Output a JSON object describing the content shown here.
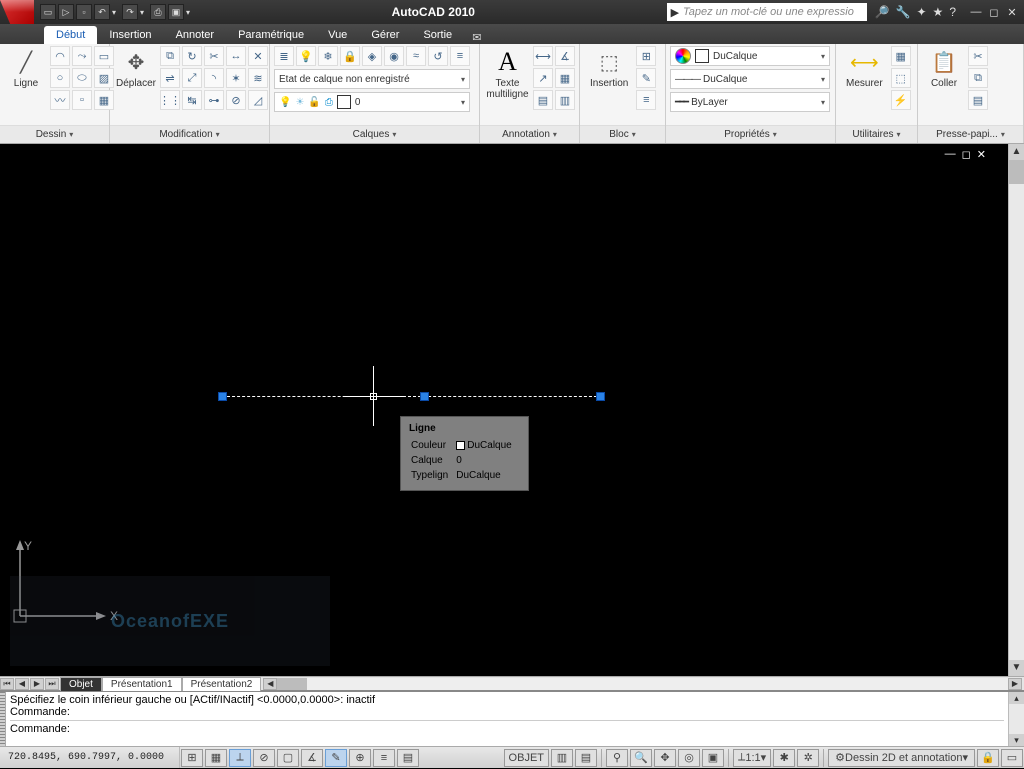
{
  "app": {
    "title": "AutoCAD 2010"
  },
  "search": {
    "placeholder": "Tapez un mot-clé ou une expressio"
  },
  "menu_tabs": {
    "debut": "Début",
    "insertion": "Insertion",
    "annoter": "Annoter",
    "parametrique": "Paramétrique",
    "vue": "Vue",
    "gerer": "Gérer",
    "sortie": "Sortie"
  },
  "panels": {
    "dessin": {
      "label": "Dessin",
      "ligne": "Ligne"
    },
    "modif": {
      "label": "Modification",
      "deplacer": "Déplacer"
    },
    "calques": {
      "label": "Calques",
      "state": "Etat de calque non enregistré",
      "current": "0"
    },
    "annot": {
      "label": "Annotation",
      "texte": "Texte\nmultiligne"
    },
    "bloc": {
      "label": "Bloc",
      "insertion": "Insertion"
    },
    "props": {
      "label": "Propriétés",
      "color": "DuCalque",
      "ltype": "DuCalque",
      "lweight": "ByLayer"
    },
    "util": {
      "label": "Utilitaires",
      "mesurer": "Mesurer"
    },
    "presse": {
      "label": "Presse-papi...",
      "coller": "Coller"
    }
  },
  "tooltip": {
    "title": "Ligne",
    "rows": [
      {
        "k": "Couleur",
        "v": "DuCalque",
        "sw": true
      },
      {
        "k": "Calque",
        "v": "0"
      },
      {
        "k": "Typelign",
        "v": "DuCalque"
      }
    ]
  },
  "ucs": {
    "x": "X",
    "y": "Y"
  },
  "watermark": "OceanofEXE",
  "layout": {
    "objet": "Objet",
    "p1": "Présentation1",
    "p2": "Présentation2"
  },
  "command": {
    "l1": "Spécifiez le coin inférieur gauche ou [ACtif/INactif] <0.0000,0.0000>: inactif",
    "l2": "Commande:",
    "l3": "Commande:"
  },
  "status": {
    "coords": "720.8495, 690.7997, 0.0000",
    "objet": "OBJET",
    "scale": "1:1",
    "workspace": "Dessin 2D et annotation"
  }
}
